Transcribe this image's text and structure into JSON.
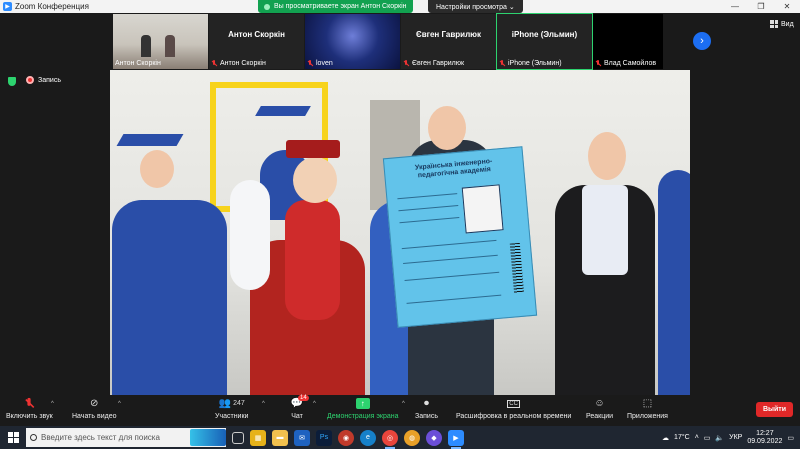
{
  "window": {
    "title": "Zoom Конференция",
    "controls": [
      "—",
      "❐",
      "✕"
    ]
  },
  "share_banner": {
    "text": "Вы просматриваете экран Антон Скоркін",
    "view_options": "Настройки просмотра ⌄"
  },
  "thumbnails": [
    {
      "center_name": "",
      "label": "Антон Скоркін",
      "muted": false,
      "kind": "video-room"
    },
    {
      "center_name": "Антон Скоркін",
      "label": "Антон Скоркін",
      "muted": true,
      "kind": "name"
    },
    {
      "center_name": "",
      "label": "loven",
      "muted": true,
      "kind": "avatar"
    },
    {
      "center_name": "Євген Гаврилюк",
      "label": "Євген Гаврилюк",
      "muted": true,
      "kind": "name"
    },
    {
      "center_name": "iPhone (Эльмин)",
      "label": "iPhone (Эльмин)",
      "muted": true,
      "kind": "name-active"
    },
    {
      "center_name": "",
      "label": "Влад Самойлов",
      "muted": true,
      "kind": "black"
    }
  ],
  "view_button": "Вид",
  "recording_label": "Запись",
  "shared_card": {
    "title": "Українська інженерно-педагогічна академія"
  },
  "toolbar": {
    "audio": "Включить звук",
    "video": "Начать видео",
    "participants": "Участники",
    "participants_count": "247",
    "chat": "Чат",
    "chat_badge": "14",
    "share": "Демонстрация экрана",
    "record": "Запись",
    "captions": "Расшифровка в реальном времени",
    "reactions": "Реакции",
    "apps": "Приложения",
    "leave": "Выйти"
  },
  "taskbar": {
    "search_placeholder": "Введите здесь текст для поиска",
    "weather": "17°C",
    "language": "УКР",
    "time": "12:27",
    "date": "09.09.2022"
  },
  "colors": {
    "accent_green": "#2dd36f",
    "leave_red": "#e02828",
    "zoom_blue": "#2d8cff",
    "robe_blue": "#2a4ea8",
    "card_blue": "#62c3ea"
  }
}
